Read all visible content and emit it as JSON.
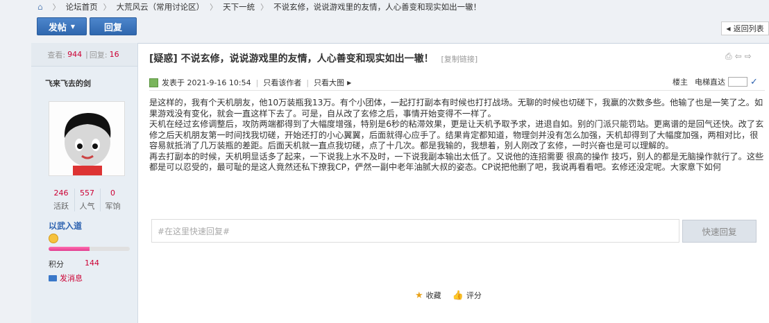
{
  "breadcrumb": {
    "items": [
      "论坛首页",
      "大荒风云（常用讨论区）",
      "天下一统",
      "不说玄修，说说游戏里的友情，人心善变和现实如出一辙！"
    ]
  },
  "toolbar": {
    "post_label": "发帖",
    "reply_label": "回复",
    "back_label": "返回列表"
  },
  "sidebar": {
    "views_label": "查看:",
    "views": "944",
    "replies_label": "回复:",
    "replies": "16",
    "username": "飞来飞去的剑",
    "stats": [
      {
        "value": "246",
        "label": "活跃"
      },
      {
        "value": "557",
        "label": "人气"
      },
      {
        "value": "0",
        "label": "军饷"
      }
    ],
    "group": "以武入道",
    "progress": 0.5,
    "score_label": "积分",
    "score": "144",
    "message_label": "发消息"
  },
  "post": {
    "title": "[疑惑] 不说玄修，说说游戏里的友情，人心善变和现实如出一辙！",
    "copy_link": "[复制链接]",
    "posted": "发表于 2021-9-16 10:54",
    "only_author": "只看该作者",
    "only_image": "只看大图",
    "floor": "楼主",
    "elevator": "电梯直达",
    "content": [
      "是这样的，我有个天机朋友，他10万装瓶我13万。有个小团体，一起打打副本有时候也打打战场。无聊的时候也切磋下，我赢的次数多些。他输了也是一笑了之。如果游戏没有变化，就会一直这样下去了。可是，自从改了玄修之后，事情开始变得不一样了。",
      "天机在经过玄修调整后，攻防两端都得到了大幅度增强，特别是6秒的粘滞效果，更是让天机予取予求，进退自如。别的门派只能罚站。更离谱的是回气还快。改了玄修之后天机朋友第一时间找我切磋，开始还打的小心翼翼，后面就得心应手了。结果肯定都知道，物理剑并没有怎么加强，天机却得到了大幅度加强，两相对比，很容易就抵消了几万装瓶的差距。后面天机就一直点我切磋，点了十几次。都是我输的，我想着，别人刚改了玄修，一时兴奋也是可以理解的。",
      "再去打副本的时候，天机明显话多了起来，一下说我上水不及时，一下说我副本输出太低了。又说他的连招需要 很高的操作 技巧，别人的都是无脑操作就行了。这些都是可以忍受的，最可耻的是这人竟然还私下撩我CP，俨然一副中老年油腻大叔的姿态。CP说把他删了吧，我说再看看吧。玄修还没定呢。大家意下如何"
    ]
  },
  "quick_reply": {
    "placeholder": "#在这里快速回复#",
    "button": "快速回复"
  },
  "actions": {
    "favorite": "收藏",
    "rate": "评分"
  }
}
